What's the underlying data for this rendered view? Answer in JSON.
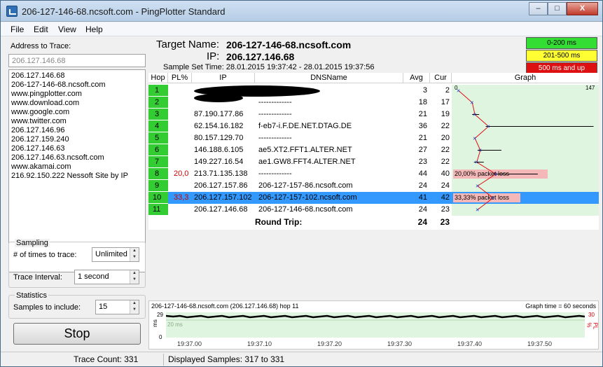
{
  "window": {
    "title": "206-127-146-68.ncsoft.com - PingPlotter Standard",
    "minimize": "–",
    "maximize": "□",
    "close": "X"
  },
  "menu": [
    "File",
    "Edit",
    "View",
    "Help"
  ],
  "left": {
    "address_label": "Address to Trace:",
    "address_value": "206.127.146.68",
    "addresses": [
      "206.127.146.68",
      "206-127-146-68.ncsoft.com",
      "www.pingplotter.com",
      "www.download.com",
      "www.google.com",
      "www.twitter.com",
      "206.127.146.96",
      "206.127.159.240",
      "206.127.146.63",
      "206.127.146.63.ncsoft.com",
      "www.akamai.com",
      "216.92.150.222 Nessoft Site by IP"
    ],
    "sampling_label": "Sampling",
    "times_label": "# of times to trace:",
    "times_value": "Unlimited",
    "interval_label": "Trace Interval:",
    "interval_value": "1 second",
    "statistics_label": "Statistics",
    "samples_label": "Samples to include:",
    "samples_value": "15",
    "stop_label": "Stop"
  },
  "header": {
    "target_key": "Target Name:",
    "target_value": "206-127-146-68.ncsoft.com",
    "ip_key": "IP:",
    "ip_value": "206.127.146.68",
    "sample_time": "Sample Set Time:  28.01.2015 19:37:42 - 28.01.2015 19:37:56"
  },
  "legend": [
    {
      "label": "0-200 ms",
      "color": "#33dd33"
    },
    {
      "label": "201-500 ms",
      "color": "#ffff33"
    },
    {
      "label": "500 ms and up",
      "color": "#dd1111"
    }
  ],
  "columns": {
    "hop": "Hop",
    "pl": "PL%",
    "ip": "IP",
    "dns": "DNSName",
    "avg": "Avg",
    "cur": "Cur",
    "graph": "Graph"
  },
  "graph_scale": {
    "min": "0",
    "max": "147"
  },
  "chart_data": {
    "type": "table",
    "hops": [
      {
        "hop": "1",
        "pl": "",
        "ip": "",
        "dns": "",
        "avg": 3,
        "cur": 2,
        "redacted": true
      },
      {
        "hop": "2",
        "pl": "",
        "ip": "",
        "dns": "-------------",
        "avg": 18,
        "cur": 17,
        "redacted": true
      },
      {
        "hop": "3",
        "pl": "",
        "ip": "87.190.177.86",
        "dns": "-------------",
        "avg": 21,
        "cur": 19
      },
      {
        "hop": "4",
        "pl": "",
        "ip": "62.154.16.182",
        "dns": "f-eb7-i.F.DE.NET.DTAG.DE",
        "avg": 36,
        "cur": 22
      },
      {
        "hop": "5",
        "pl": "",
        "ip": "80.157.129.70",
        "dns": "-------------",
        "avg": 21,
        "cur": 20
      },
      {
        "hop": "6",
        "pl": "",
        "ip": "146.188.6.105",
        "dns": "ae5.XT2.FFT1.ALTER.NET",
        "avg": 27,
        "cur": 22
      },
      {
        "hop": "7",
        "pl": "",
        "ip": "149.227.16.54",
        "dns": "ae1.GW8.FFT4.ALTER.NET",
        "avg": 23,
        "cur": 22
      },
      {
        "hop": "8",
        "pl": "20,0",
        "ip": "213.71.135.138",
        "dns": "-------------",
        "avg": 44,
        "cur": 40,
        "loss_label": "20,00% packet loss"
      },
      {
        "hop": "9",
        "pl": "",
        "ip": "206.127.157.86",
        "dns": "206-127-157-86.ncsoft.com",
        "avg": 24,
        "cur": 24
      },
      {
        "hop": "10",
        "pl": "33,3",
        "ip": "206.127.157.102",
        "dns": "206-127-157-102.ncsoft.com",
        "avg": 41,
        "cur": 42,
        "loss_label": "33,33% packet loss",
        "selected": true
      },
      {
        "hop": "11",
        "pl": "",
        "ip": "206.127.146.68",
        "dns": "206-127-146-68.ncsoft.com",
        "avg": 24,
        "cur": 23
      }
    ],
    "graph_max_ms": 147,
    "round_trip": {
      "label": "Round Trip:",
      "avg": 24,
      "cur": 23
    }
  },
  "timeline": {
    "title": "206-127-146-68.ncsoft.com (206.127.146.68) hop 11",
    "graph_time": "Graph time = 60 seconds",
    "y_max": "29",
    "y_mid": "20 ms",
    "y_min": "0",
    "y_unit": "ms",
    "pl_max": "30",
    "pl_unit": "PL %",
    "ticks": [
      "19:37.00",
      "19:37.10",
      "19:37.20",
      "19:37.30",
      "19:37.40",
      "19:37.50"
    ]
  },
  "status": {
    "trace_count": "Trace Count: 331",
    "displayed": "Displayed Samples: 317 to 331"
  }
}
